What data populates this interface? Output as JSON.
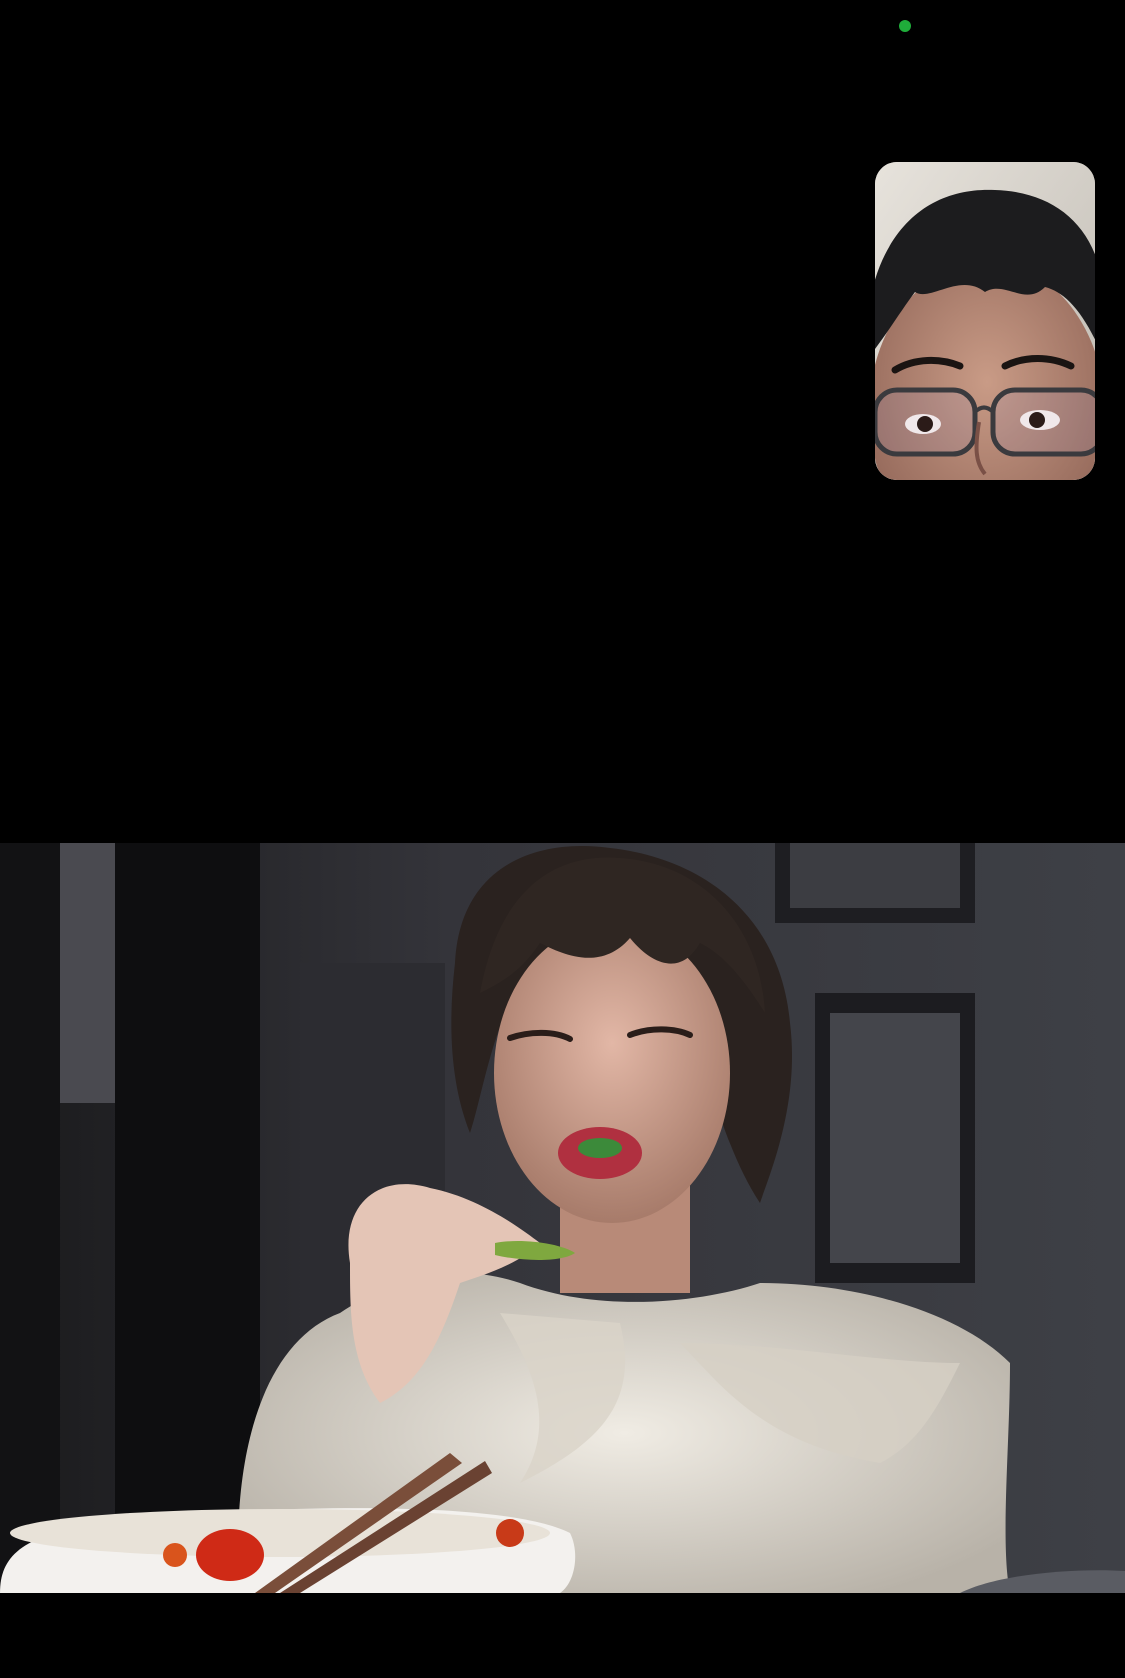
{
  "status_indicator": {
    "color": "#1FAD3A",
    "meaning": "camera-in-use"
  },
  "call": {
    "self_view": {
      "label": "self-camera-preview"
    },
    "remote_view": {
      "label": "remote-participant-video"
    }
  }
}
